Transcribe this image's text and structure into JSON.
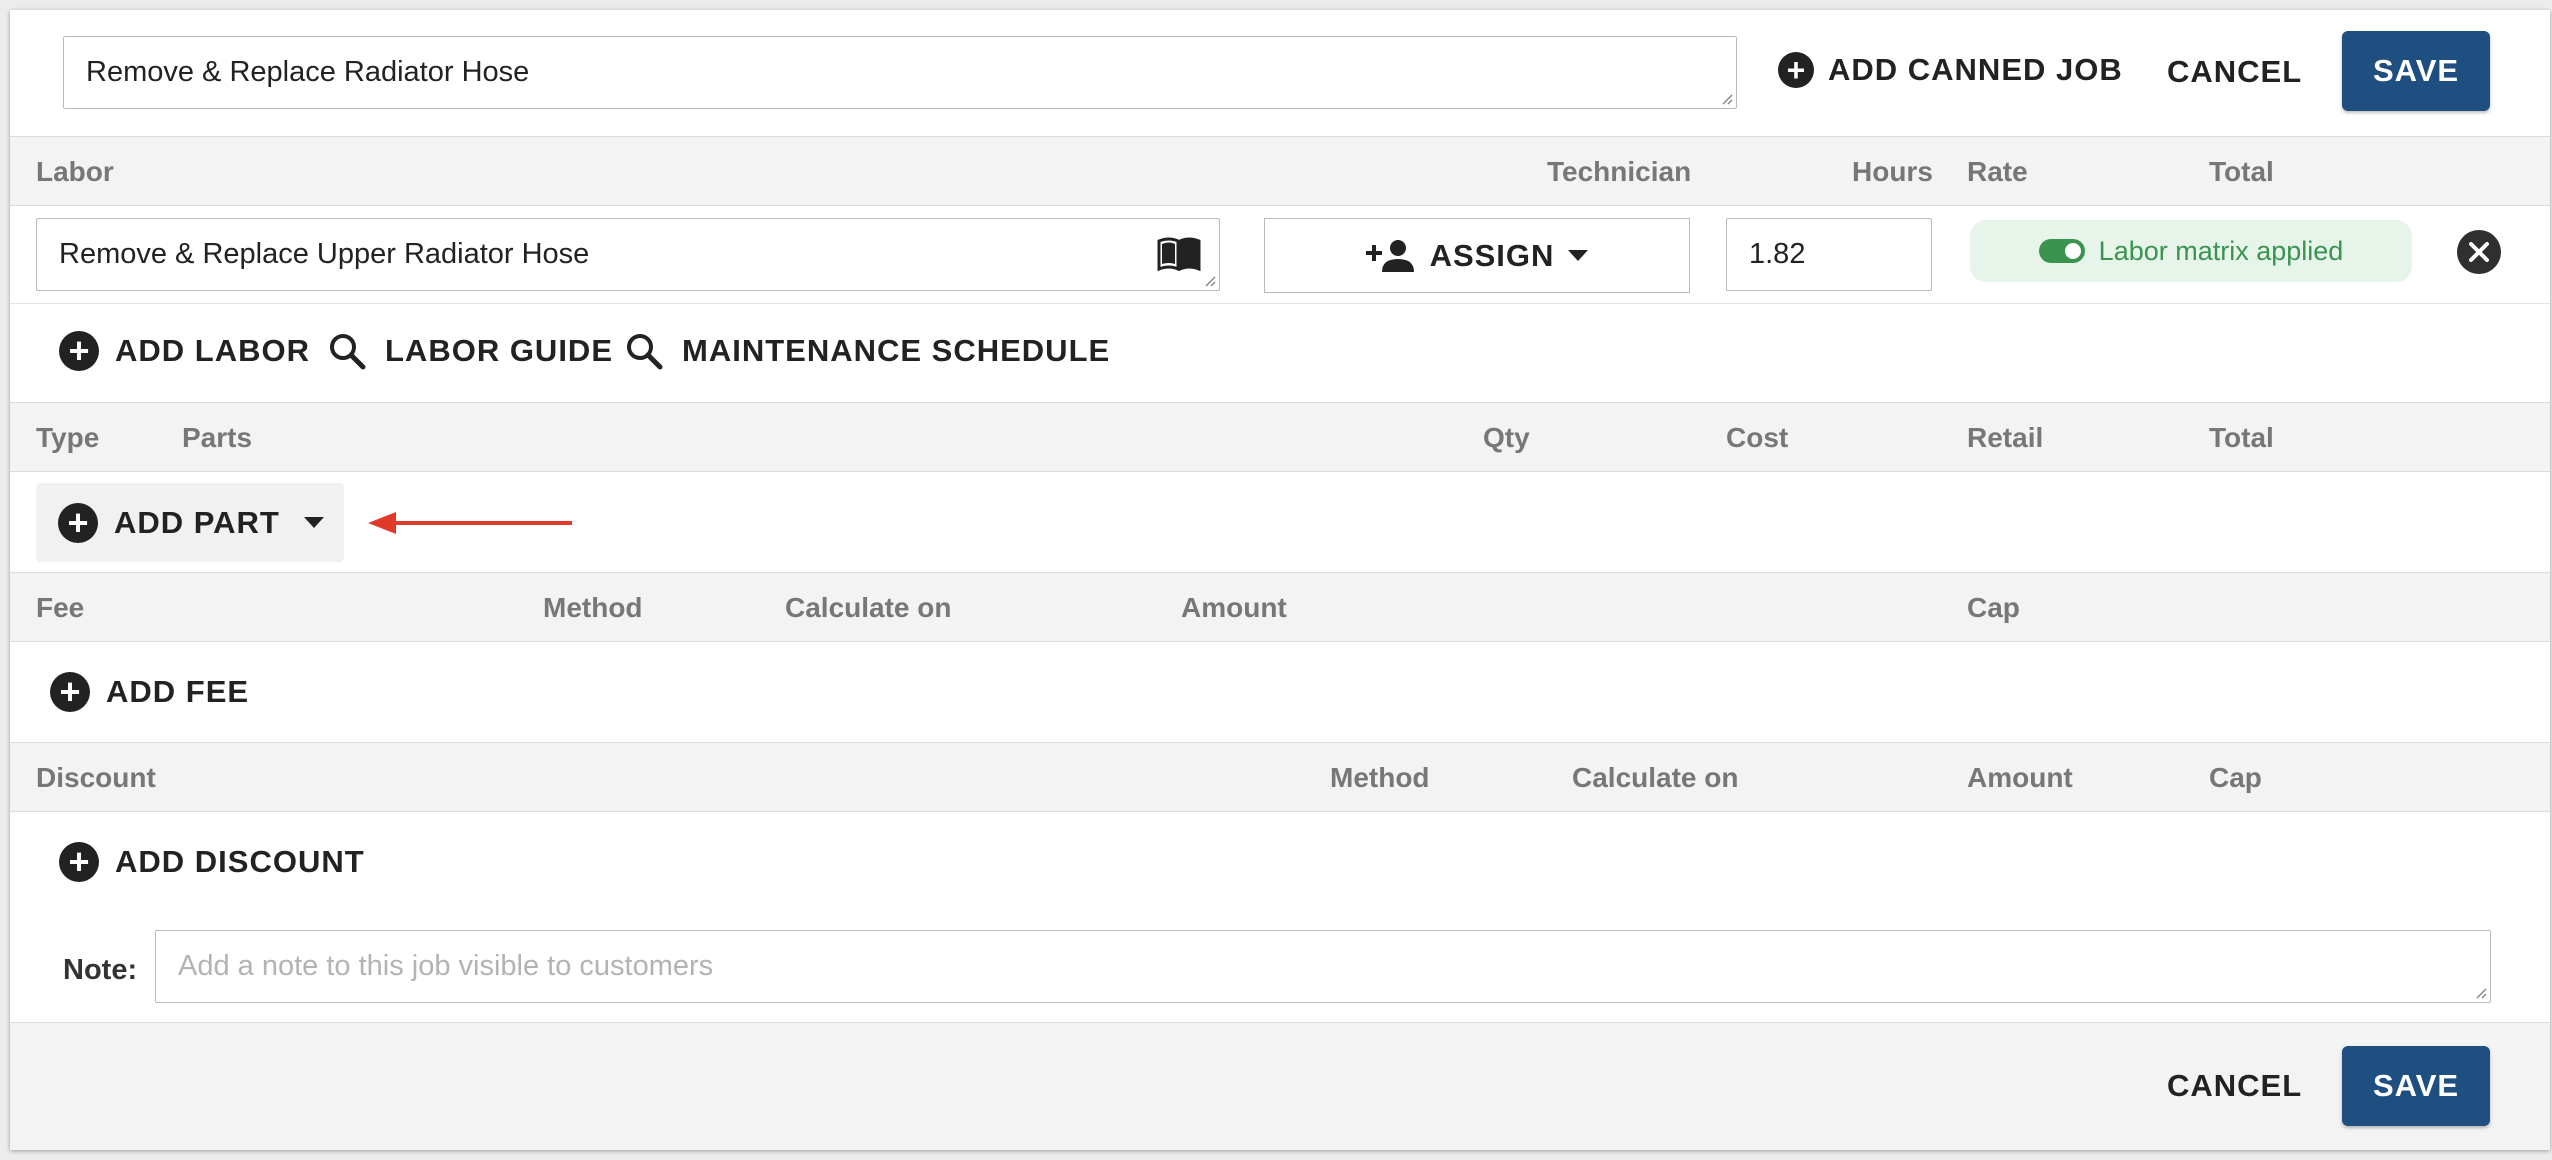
{
  "job": {
    "title_value": "Remove & Replace Radiator Hose",
    "add_canned_job_label": "ADD CANNED JOB",
    "cancel_label": "CANCEL",
    "save_label": "SAVE"
  },
  "labor": {
    "headers": {
      "labor": "Labor",
      "technician": "Technician",
      "hours": "Hours",
      "rate": "Rate",
      "total": "Total"
    },
    "row": {
      "description": "Remove & Replace Upper Radiator Hose",
      "assign_label": "ASSIGN",
      "hours": "1.82",
      "rate_badge": "Labor matrix applied"
    },
    "actions": {
      "add_labor": "ADD LABOR",
      "labor_guide": "LABOR GUIDE",
      "maintenance_schedule": "MAINTENANCE SCHEDULE"
    }
  },
  "parts": {
    "headers": {
      "type": "Type",
      "parts": "Parts",
      "qty": "Qty",
      "cost": "Cost",
      "retail": "Retail",
      "total": "Total"
    },
    "add_part_label": "ADD PART"
  },
  "fees": {
    "headers": {
      "fee": "Fee",
      "method": "Method",
      "calculate_on": "Calculate on",
      "amount": "Amount",
      "cap": "Cap"
    },
    "add_fee_label": "ADD FEE"
  },
  "discounts": {
    "headers": {
      "discount": "Discount",
      "method": "Method",
      "calculate_on": "Calculate on",
      "amount": "Amount",
      "cap": "Cap"
    },
    "add_discount_label": "ADD DISCOUNT"
  },
  "note": {
    "label": "Note:",
    "placeholder": "Add a note to this job visible to customers"
  },
  "footer": {
    "cancel_label": "CANCEL",
    "save_label": "SAVE"
  },
  "colors": {
    "primary": "#1f4e80",
    "badge_green": "#3a9450",
    "badge_bg": "#e6f4ea",
    "arrow_red": "#e03b2a"
  }
}
